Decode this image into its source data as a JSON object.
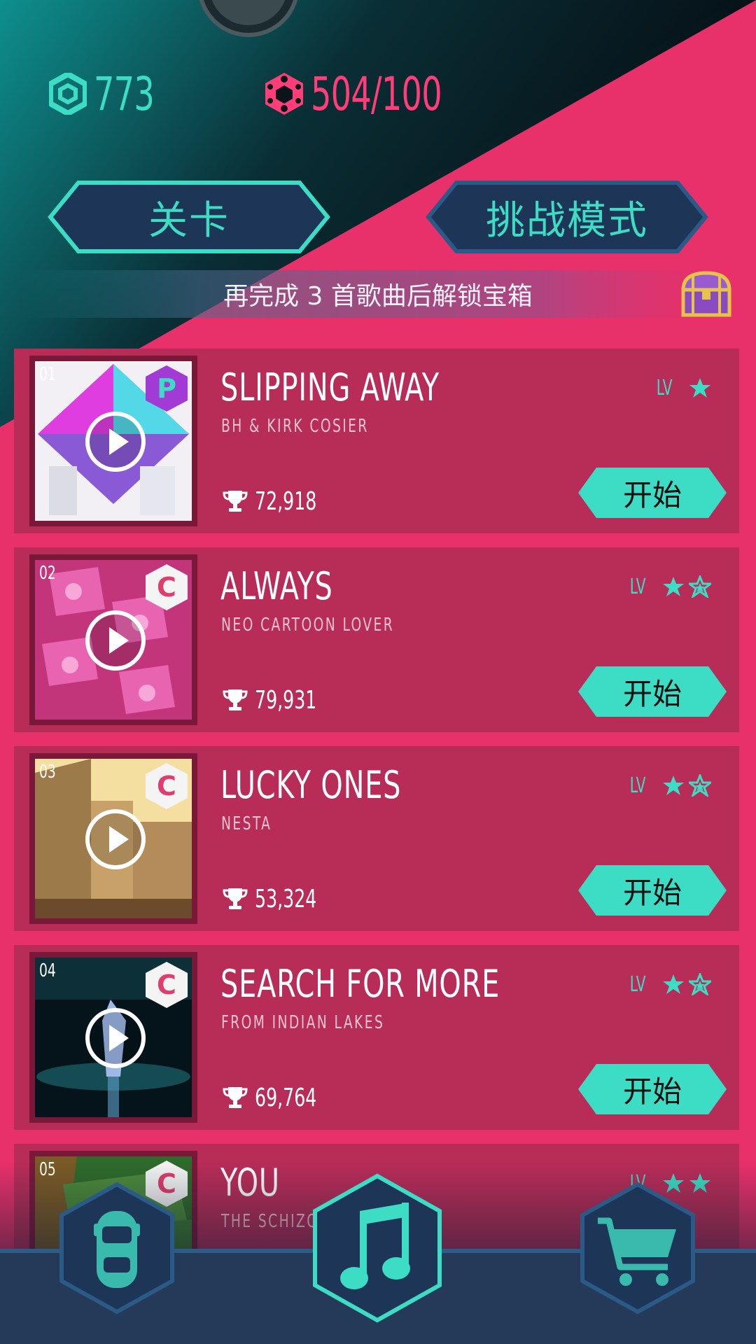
{
  "currency": {
    "gems_value": "773",
    "parts_value": "504/100"
  },
  "tabs": {
    "levels_label": "关卡",
    "challenge_label": "挑战模式"
  },
  "banner": {
    "text": "再完成 3 首歌曲后解锁宝箱"
  },
  "songs": [
    {
      "num": "01",
      "title": "SLIPPING AWAY",
      "artist": "BH & KIRK COSIER",
      "score": "72,918",
      "lv_label": "LV",
      "stars": 1,
      "badge": "P",
      "start_label": "开始"
    },
    {
      "num": "02",
      "title": "ALWAYS",
      "artist": "NEO CARTOON LOVER",
      "score": "79,931",
      "lv_label": "LV",
      "stars": 2,
      "badge": "C",
      "start_label": "开始"
    },
    {
      "num": "03",
      "title": "LUCKY ONES",
      "artist": "NESTA",
      "score": "53,324",
      "lv_label": "LV",
      "stars": 2,
      "badge": "C",
      "start_label": "开始"
    },
    {
      "num": "04",
      "title": "SEARCH FOR MORE",
      "artist": "FROM INDIAN LAKES",
      "score": "69,764",
      "lv_label": "LV",
      "stars": 2,
      "badge": "C",
      "start_label": "开始"
    },
    {
      "num": "05",
      "title": "YOU",
      "artist": "THE SCHIZO",
      "score": "",
      "lv_label": "LV",
      "stars": 2,
      "badge": "C",
      "start_label": ""
    }
  ],
  "nav": {
    "items": [
      "car-icon",
      "music-note-icon",
      "shopping-cart-icon"
    ],
    "active": "music-note-icon"
  },
  "colors": {
    "accent_teal": "#3ddcc5",
    "accent_pink": "#e8306a",
    "card_bg": "#b82c58",
    "tab_bg": "#1d3557"
  }
}
